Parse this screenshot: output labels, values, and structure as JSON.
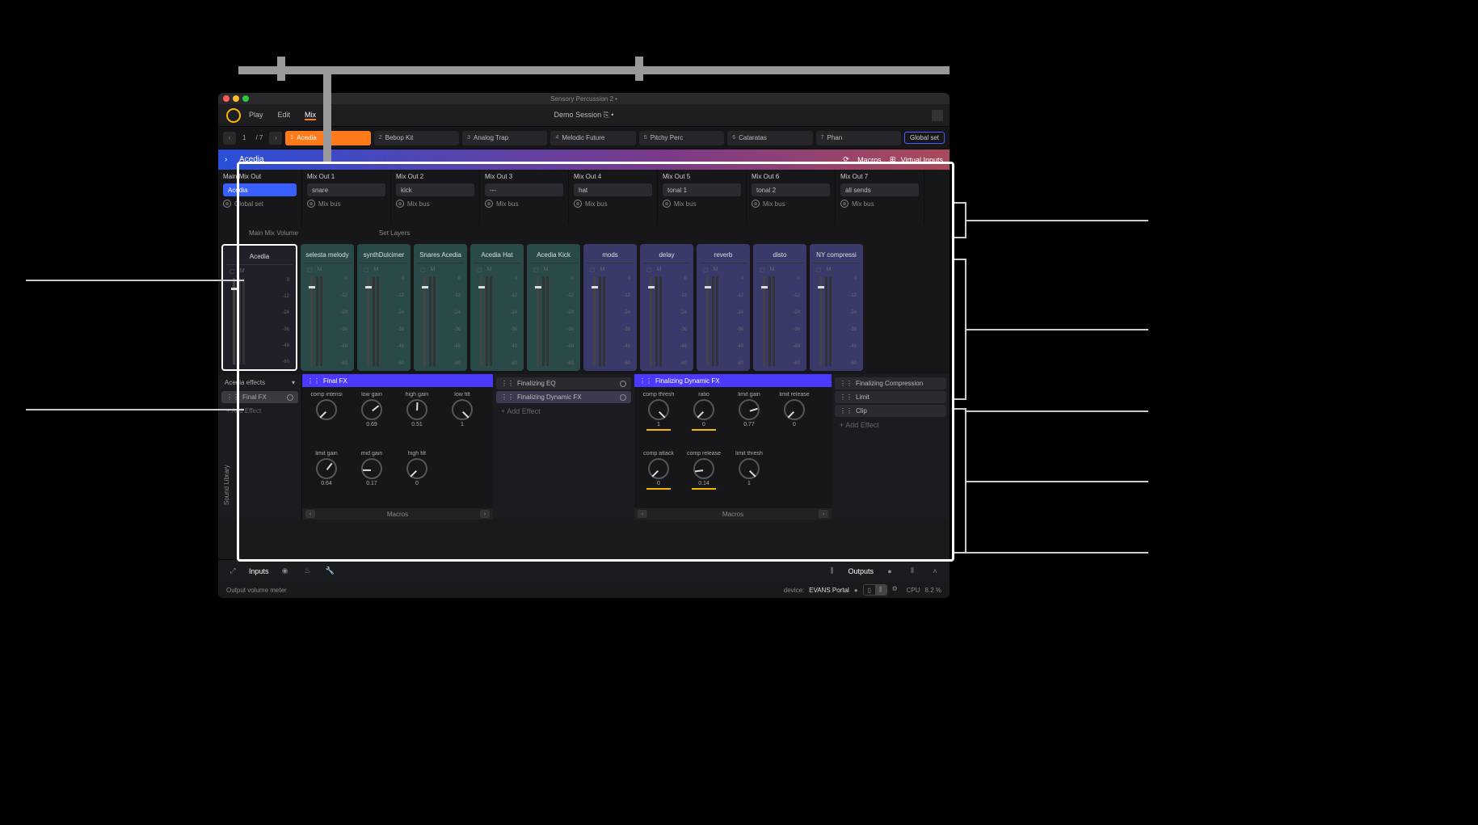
{
  "window": {
    "title": "Sensory Percussion 2 •",
    "session": "Demo Session ⎘  •"
  },
  "menu": [
    "Play",
    "Edit",
    "Mix"
  ],
  "preset_nav": {
    "page": "1",
    "total": "/ 7"
  },
  "presets": [
    {
      "n": "1",
      "name": "Acedia",
      "active": true
    },
    {
      "n": "2",
      "name": "Bebop Kit"
    },
    {
      "n": "3",
      "name": "Analog Trap"
    },
    {
      "n": "4",
      "name": "Melodic Future"
    },
    {
      "n": "5",
      "name": "Pitchy Perc"
    },
    {
      "n": "6",
      "name": "Cataratas"
    },
    {
      "n": "7",
      "name": "Phan"
    }
  ],
  "global_set_btn": "Global set",
  "set_header": {
    "name": "Acedia",
    "macros": "Macros",
    "virtual": "Virtual Inputs"
  },
  "mix_outs": [
    {
      "label": "Main Mix Out",
      "name": "Acedia",
      "bus": "Global set",
      "primary": true
    },
    {
      "label": "Mix Out 1",
      "name": "snare",
      "bus": "Mix bus"
    },
    {
      "label": "Mix Out 2",
      "name": "kick",
      "bus": "Mix bus"
    },
    {
      "label": "Mix Out 3",
      "name": "---",
      "bus": "Mix bus"
    },
    {
      "label": "Mix Out 4",
      "name": "hat",
      "bus": "Mix bus"
    },
    {
      "label": "Mix Out 5",
      "name": "tonal 1",
      "bus": "Mix bus"
    },
    {
      "label": "Mix Out 6",
      "name": "tonal 2",
      "bus": "Mix bus"
    },
    {
      "label": "Mix Out 7",
      "name": "all sends",
      "bus": "Mix bus"
    }
  ],
  "section_labels": {
    "main_vol": "Main Mix Volume",
    "layers": "Set Layers"
  },
  "channels": [
    {
      "name": "Acedia",
      "main": true
    },
    {
      "name": "selesta melody",
      "cls": "set-layer"
    },
    {
      "name": "synthDulcimer",
      "cls": "set-layer"
    },
    {
      "name": "Snares Acedia",
      "cls": "set-layer"
    },
    {
      "name": "Acedia Hat",
      "cls": "set-layer"
    },
    {
      "name": "Acedia Kick",
      "cls": "set-layer"
    },
    {
      "name": "mods",
      "cls": "set-layer purple"
    },
    {
      "name": "delay",
      "cls": "set-layer purple"
    },
    {
      "name": "reverb",
      "cls": "set-layer purple"
    },
    {
      "name": "disto",
      "cls": "set-layer purple"
    },
    {
      "name": "NY compressi",
      "cls": "set-layer purple"
    }
  ],
  "channel_sm": {
    "solo": "",
    "mute": "M"
  },
  "db_scale": [
    "0",
    "-12",
    "-24",
    "-36",
    "-48",
    "-60"
  ],
  "fx_sidebar": {
    "header": "Acedia effects",
    "items": [
      {
        "name": "Final FX",
        "active": true
      }
    ],
    "add": "+ Add Effect"
  },
  "fx_final": {
    "title": "Final FX",
    "knobs_row1": [
      {
        "label": "comp intensi",
        "val": ""
      },
      {
        "label": "low gain",
        "val": "0.69"
      },
      {
        "label": "high gain",
        "val": "0.51"
      },
      {
        "label": "low filt",
        "val": "1"
      }
    ],
    "knobs_row2": [
      {
        "label": "limit gain",
        "val": "0.64"
      },
      {
        "label": "mid gain",
        "val": "0.17"
      },
      {
        "label": "high filt",
        "val": "0"
      }
    ],
    "macros": "Macros"
  },
  "fx_mid": {
    "items": [
      {
        "name": "Finalizing EQ"
      },
      {
        "name": "Finalizing Dynamic FX",
        "selected": true
      }
    ],
    "add": "+ Add Effect"
  },
  "fx_dyn": {
    "title": "Finalizing Dynamic FX",
    "knobs_row1": [
      {
        "label": "comp thresh",
        "val": "1",
        "accent": true
      },
      {
        "label": "ratio",
        "val": "0",
        "accent": true
      },
      {
        "label": "limit gain",
        "val": "0.77"
      },
      {
        "label": "limit release",
        "val": "0"
      }
    ],
    "knobs_row2": [
      {
        "label": "comp attack",
        "val": "0",
        "accent": true
      },
      {
        "label": "comp release",
        "val": "0.14",
        "accent": true
      },
      {
        "label": "limit thresh",
        "val": "1"
      }
    ],
    "macros": "Macros"
  },
  "fx_far": {
    "items": [
      {
        "name": "Finalizing Compression"
      },
      {
        "name": "Limit"
      },
      {
        "name": "Clip"
      }
    ],
    "add": "+ Add Effect"
  },
  "bottom": {
    "inputs": "Inputs",
    "outputs": "Outputs"
  },
  "status": {
    "left": "Output volume meter",
    "device_label": "device:",
    "device": "EVANS Portal",
    "cpu_label": "CPU",
    "cpu": "8.2 %"
  },
  "sidebar_vertical": "Sound Library"
}
